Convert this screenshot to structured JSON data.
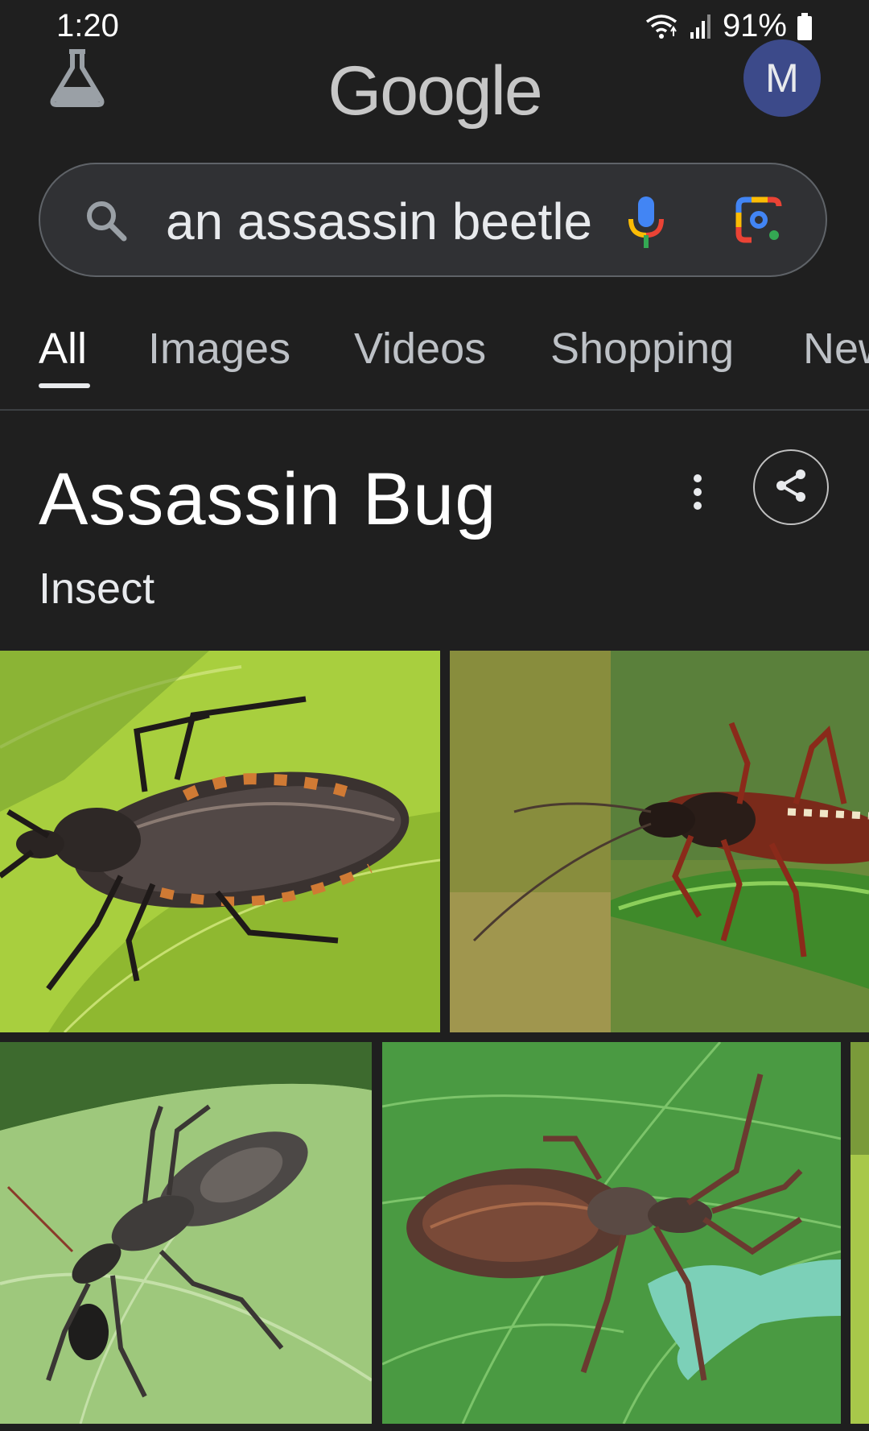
{
  "status_bar": {
    "time": "1:20",
    "battery": "91%",
    "icons": [
      "wifi-icon",
      "signal-icon",
      "battery-icon"
    ]
  },
  "header": {
    "labs_icon": "flask-icon",
    "logo": "Google",
    "avatar_initial": "M",
    "avatar_color": "#3c4a8a"
  },
  "search": {
    "query": "an assassin beetle",
    "icons": [
      "search-icon",
      "mic-icon",
      "lens-icon"
    ]
  },
  "tabs": [
    {
      "label": "All",
      "active": true
    },
    {
      "label": "Images",
      "active": false
    },
    {
      "label": "Videos",
      "active": false
    },
    {
      "label": "Shopping",
      "active": false
    },
    {
      "label": "News",
      "active": false
    }
  ],
  "knowledge_panel": {
    "title": "Assassin Bug",
    "subtitle": "Insect",
    "icons": [
      "more-vert-icon",
      "share-icon"
    ],
    "images": [
      "assassin bug on bright green leaf with orange-banded abdomen",
      "red and black assassin bug on leaf edge",
      "grey wheel bug with prey on leaf",
      "brown assassin bug with caterpillar on green leaf",
      "partially visible image"
    ]
  }
}
